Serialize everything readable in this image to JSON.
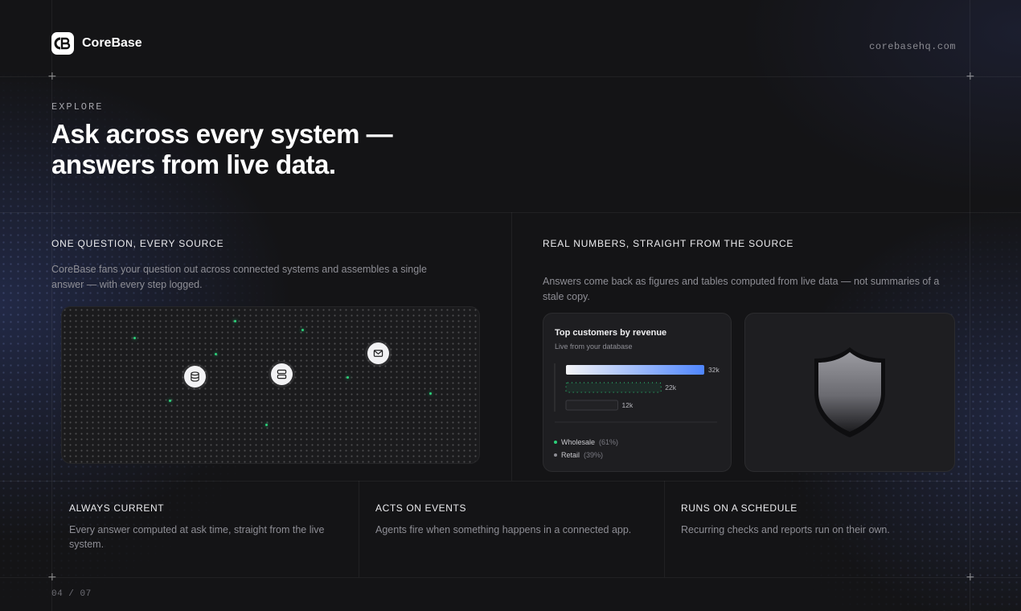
{
  "brand": {
    "name": "CoreBase",
    "logo_text": "CB",
    "url": "corebasehq.com"
  },
  "hero": {
    "eyebrow": "EXPLORE",
    "headline": "Ask across every system — answers from live data."
  },
  "sections": {
    "left": {
      "title": "ONE QUESTION, EVERY SOURCE",
      "description": "CoreBase fans your question out across connected systems and assembles a single answer — with every step logged.",
      "source_icons": [
        "database-icon",
        "server-icon",
        "mail-icon"
      ]
    },
    "right": {
      "title": "REAL NUMBERS, STRAIGHT FROM THE SOURCE",
      "description": "Answers come back as figures and tables computed from live data — not summaries of a stale copy."
    }
  },
  "chart_card": {
    "title": "Top customers by revenue",
    "subtitle": "Live from your database",
    "legend": [
      {
        "label": "Wholesale",
        "pct": "(61%)",
        "color": "#2bd17a"
      },
      {
        "label": "Retail",
        "pct": "(39%)",
        "color": "#8e8e95"
      }
    ]
  },
  "chart_data": {
    "type": "bar",
    "orientation": "horizontal",
    "title": "Top customers by revenue",
    "subtitle": "Live from your database",
    "categories": [
      "",
      "",
      ""
    ],
    "values": [
      32,
      22,
      12
    ],
    "value_labels": [
      "32k",
      "22k",
      "12k"
    ],
    "colors": [
      "#5b8cff",
      "#2bd17a",
      "#3a3a3f"
    ],
    "xlim": [
      0,
      32
    ]
  },
  "features": [
    {
      "title": "ALWAYS CURRENT",
      "description": "Every answer computed at ask time, straight from the live system."
    },
    {
      "title": "ACTS ON EVENTS",
      "description": "Agents fire when something happens in a connected app."
    },
    {
      "title": "RUNS ON A SCHEDULE",
      "description": "Recurring checks and reports run on their own."
    }
  ],
  "pager": {
    "label": "04 / 07"
  }
}
